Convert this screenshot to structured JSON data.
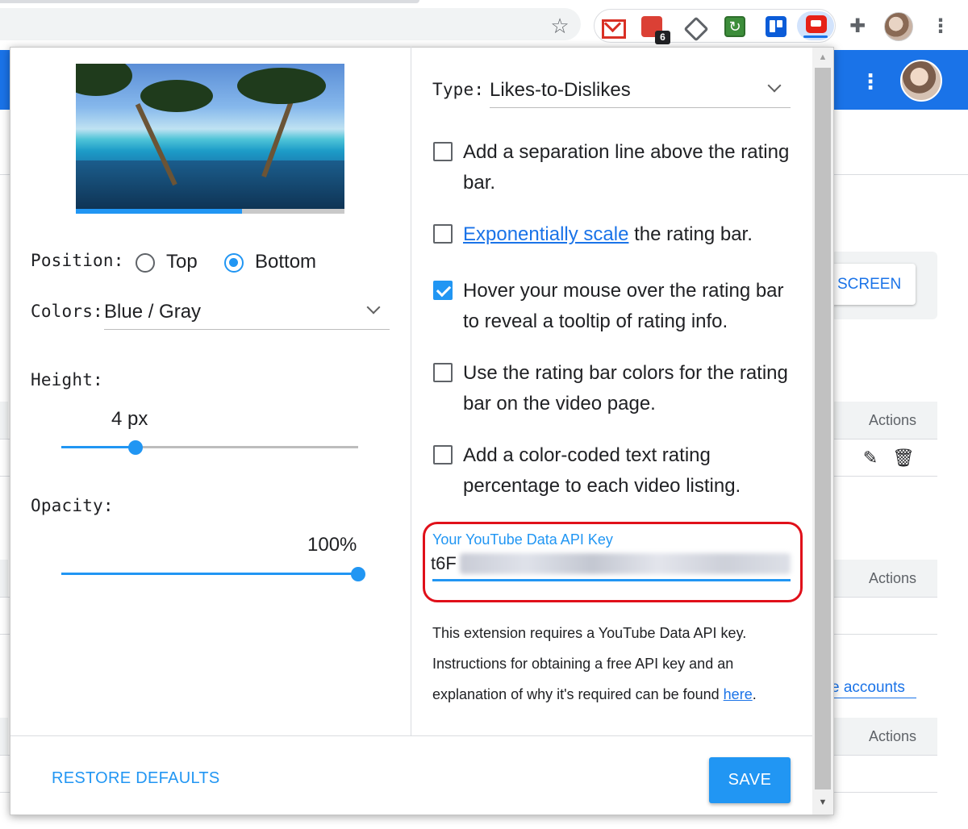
{
  "browser": {
    "todoist_badge": "6",
    "icons": [
      "star-icon",
      "gmail-icon",
      "todoist-icon",
      "feedly-icon",
      "refresh-extension-icon",
      "trello-icon",
      "return-youtube-dislike-icon",
      "puzzle-icon",
      "profile-avatar",
      "kebab-menu-icon"
    ]
  },
  "background_page": {
    "screen_button_partial": "SCREEN",
    "actions_header": "Actions",
    "accounts_link_partial": "e accounts"
  },
  "popup": {
    "position": {
      "label": "Position:",
      "options": [
        "Top",
        "Bottom"
      ],
      "selected": "Bottom"
    },
    "colors": {
      "label": "Colors:",
      "value": "Blue / Gray"
    },
    "height": {
      "label": "Height:",
      "value_text": "4 px",
      "value": 4,
      "fraction": 0.25
    },
    "opacity": {
      "label": "Opacity:",
      "value_text": "100%",
      "value": 100
    },
    "preview_bar_fraction": 0.62,
    "type": {
      "label": "Type:",
      "value": "Likes-to-Dislikes"
    },
    "checkboxes": [
      {
        "checked": false,
        "text": "Add a separation line above the rating bar."
      },
      {
        "checked": false,
        "link": "Exponentially scale",
        "text": " the rating bar."
      },
      {
        "checked": true,
        "text": "Hover your mouse over the rating bar to reveal a tooltip of rating info."
      },
      {
        "checked": false,
        "text": "Use the rating bar colors for the rating bar on the video page."
      },
      {
        "checked": false,
        "text": "Add a color-coded text rating percentage to each video listing."
      }
    ],
    "api_key": {
      "label": "Your YouTube Data API Key",
      "visible_prefix": "t6F"
    },
    "help": {
      "text": "This extension requires a YouTube Data API key. Instructions for obtaining a free API key and an explanation of why it's required can be found ",
      "link": "here",
      "suffix": "."
    },
    "restore_label": "RESTORE DEFAULTS",
    "save_label": "SAVE"
  },
  "colors": {
    "accent": "#2196f3",
    "highlight_box": "#e0101a",
    "link": "#1a73e8"
  }
}
